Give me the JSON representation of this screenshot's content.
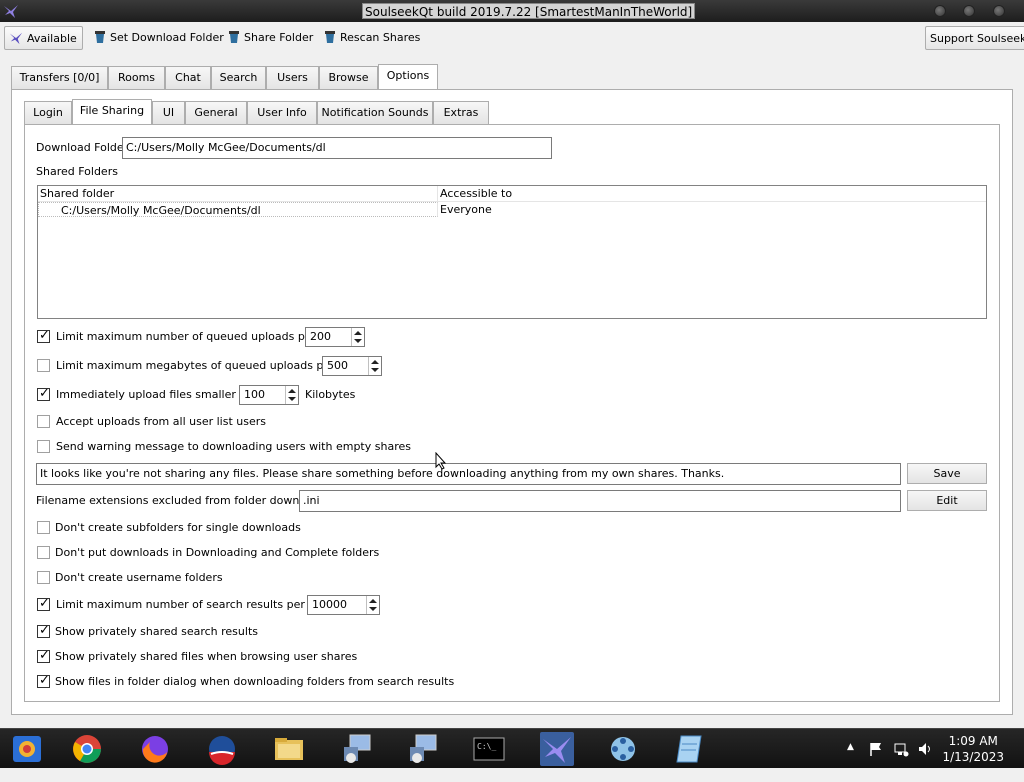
{
  "window": {
    "title": "SoulseekQt build 2019.7.22 [SmartestManInTheWorld]"
  },
  "toolbar": {
    "status_label": "Available",
    "set_download_folder": "Set Download Folder",
    "share_folder": "Share Folder",
    "rescan_shares": "Rescan Shares",
    "support": "Support Soulseek!"
  },
  "main_tabs": [
    "Transfers [0/0]",
    "Rooms",
    "Chat",
    "Search",
    "Users",
    "Browse",
    "Options"
  ],
  "main_tabs_active": "Options",
  "options_tabs": [
    "Login",
    "File Sharing",
    "UI",
    "General",
    "User Info",
    "Notification Sounds",
    "Extras"
  ],
  "options_tabs_active": "File Sharing",
  "file_sharing": {
    "download_folder_label": "Download Folder",
    "download_folder_value": "C:/Users/Molly McGee/Documents/dl",
    "shared_folders_label": "Shared Folders",
    "table_headers": [
      "Shared folder",
      "Accessible to"
    ],
    "table_rows": [
      {
        "folder": "C:/Users/Molly McGee/Documents/dl",
        "access": "Everyone"
      }
    ],
    "options": [
      {
        "label": "Limit maximum number of queued uploads per user",
        "checked": true,
        "value": "200"
      },
      {
        "label": "Limit maximum megabytes of queued uploads per user",
        "checked": false,
        "value": "500"
      },
      {
        "label": "Immediately upload files smaller than",
        "checked": true,
        "value": "100",
        "suffix": "Kilobytes"
      },
      {
        "label": "Accept uploads from all user list users",
        "checked": false
      },
      {
        "label": "Send warning message to downloading users with empty shares",
        "checked": false
      }
    ],
    "warning_message": "It looks like you're not sharing any files. Please share something before downloading anything from my own shares. Thanks.",
    "save_button": "Save",
    "excluded_label": "Filename extensions excluded from folder downloads:",
    "excluded_value": ".ini",
    "edit_button": "Edit",
    "options2": [
      {
        "label": "Don't create subfolders for single downloads",
        "checked": false
      },
      {
        "label": "Don't put downloads in Downloading and Complete folders",
        "checked": false
      },
      {
        "label": "Don't create username folders",
        "checked": false
      },
      {
        "label": "Limit maximum number of search results per search",
        "checked": true,
        "value": "10000"
      },
      {
        "label": "Show privately shared search results",
        "checked": true
      },
      {
        "label": "Show privately shared files when browsing user shares",
        "checked": true
      },
      {
        "label": "Show files in folder dialog when downloading folders from search results",
        "checked": true
      }
    ]
  },
  "taskbar": {
    "icons": [
      "photos-icon",
      "chrome-icon",
      "firefox-icon",
      "obama-logo-icon",
      "file-explorer-icon",
      "network-computer-icon",
      "network-computer-icon",
      "terminal-icon",
      "soulseek-icon",
      "joystick-icon",
      "notepad-icon"
    ],
    "time": "1:09 AM",
    "date": "1/13/2023"
  },
  "colors": {
    "taskbar": "#1a1a1a",
    "active_task": "#3a5f9e",
    "panel_border": "#adadad"
  }
}
